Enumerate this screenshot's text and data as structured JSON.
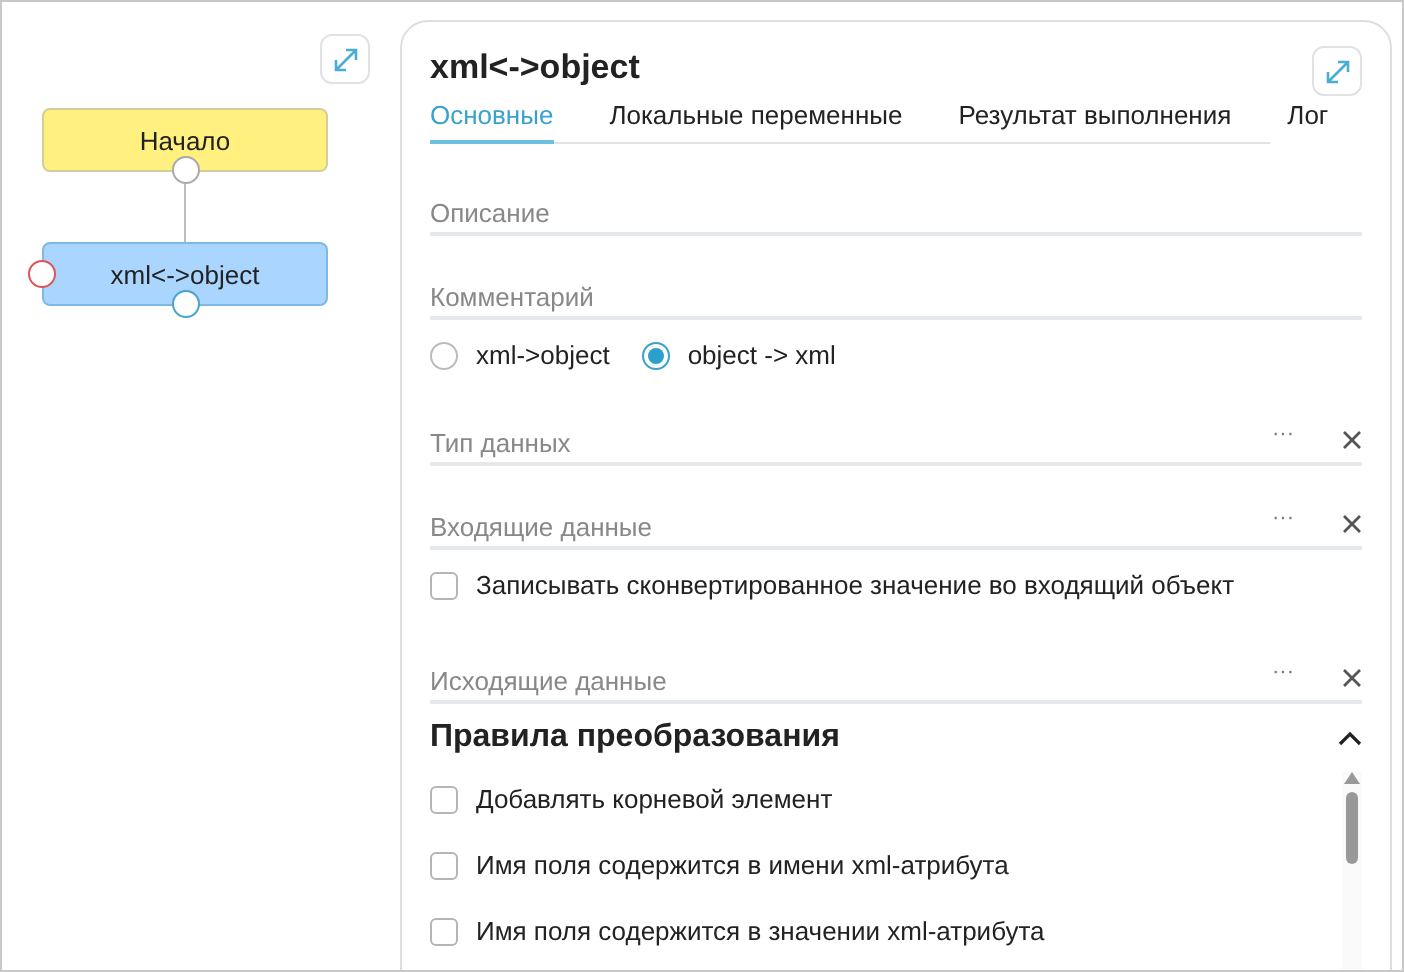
{
  "diagram": {
    "nodes": [
      {
        "label": "Начало",
        "kind": "start"
      },
      {
        "label": "xml<->object",
        "kind": "task"
      }
    ]
  },
  "panel": {
    "title": "xml<->object",
    "tabs": [
      {
        "label": "Основные",
        "selected": true
      },
      {
        "label": "Локальные переменные",
        "selected": false
      },
      {
        "label": "Результат выполнения",
        "selected": false
      },
      {
        "label": "Лог",
        "selected": false
      }
    ],
    "fields": [
      {
        "label": "Описание",
        "kind": "text"
      },
      {
        "label": "Комментарий",
        "kind": "text"
      }
    ],
    "direction": [
      {
        "label": "xml->object",
        "selected": false
      },
      {
        "label": "object -> xml",
        "selected": true
      }
    ],
    "data_fields": [
      {
        "label": "Тип данных",
        "kind": "picker",
        "more": "···"
      },
      {
        "label": "Входящие данные",
        "kind": "picker",
        "more": "···"
      },
      {
        "label": "Записывать сконвертированное значение во входящий объект",
        "kind": "checkbox",
        "checked": false
      },
      {
        "label": "Исходящие данные",
        "kind": "picker",
        "more": "···"
      }
    ],
    "rules": {
      "title": "Правила преобразования",
      "expanded": true,
      "options": [
        {
          "label": "Добавлять корневой элемент",
          "checked": false
        },
        {
          "label": "Имя поля содержится в имени xml-атрибута",
          "checked": false
        },
        {
          "label": "Имя поля содержится в значении xml-атрибута",
          "checked": false
        }
      ]
    }
  }
}
